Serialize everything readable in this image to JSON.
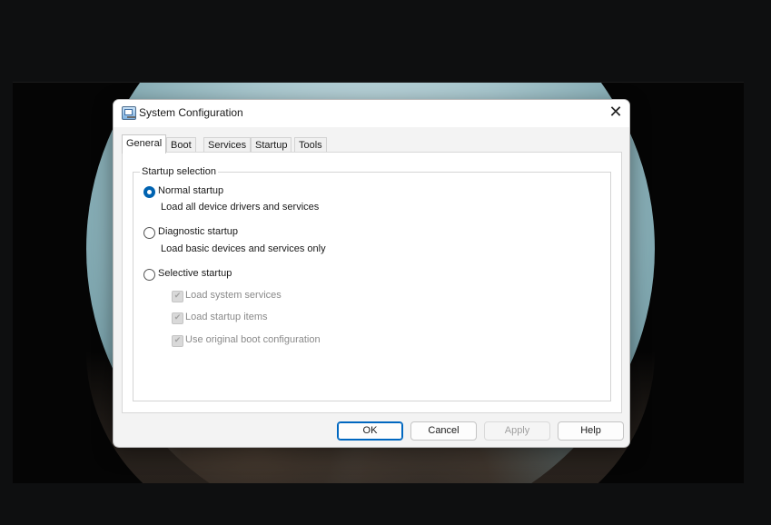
{
  "window": {
    "title": "System Configuration",
    "close_glyph": "✕"
  },
  "tabs": [
    {
      "label": "General",
      "active": true
    },
    {
      "label": "Boot",
      "active": false
    },
    {
      "label": "Services",
      "active": false
    },
    {
      "label": "Startup",
      "active": false
    },
    {
      "label": "Tools",
      "active": false
    }
  ],
  "startup_selection": {
    "legend": "Startup selection",
    "options": [
      {
        "label": "Normal startup",
        "description": "Load all device drivers and services",
        "checked": true
      },
      {
        "label": "Diagnostic startup",
        "description": "Load basic devices and services only",
        "checked": false
      },
      {
        "label": "Selective startup",
        "checked": false
      }
    ],
    "selective_items": [
      {
        "label": "Load system services",
        "checked": true,
        "disabled": true
      },
      {
        "label": "Load startup items",
        "checked": true,
        "disabled": true
      },
      {
        "label": "Use original boot configuration",
        "checked": true,
        "disabled": true
      }
    ]
  },
  "buttons": {
    "ok": "OK",
    "cancel": "Cancel",
    "apply": "Apply",
    "help": "Help"
  },
  "icons": {
    "check_glyph": "✔"
  },
  "colors": {
    "accent": "#0063b1"
  }
}
